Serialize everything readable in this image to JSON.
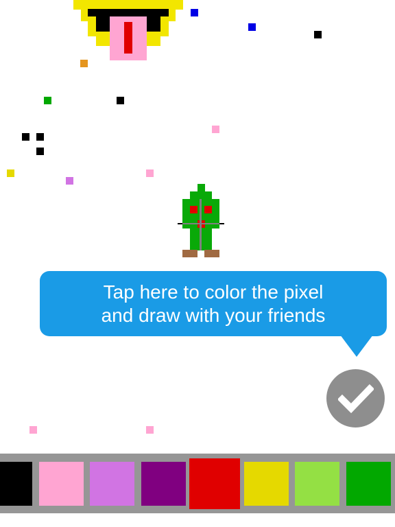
{
  "tooltip": {
    "line1": "Tap here to color the pixel",
    "line2": "and draw with your friends",
    "color": "#1a9be6"
  },
  "confirm_button": {
    "icon": "checkmark-icon",
    "color": "#8e8e8e"
  },
  "palette": {
    "background": "#969696",
    "selected_index": 4,
    "colors": [
      "#000000",
      "#ffa5d2",
      "#d174e3",
      "#800080",
      "#e00000",
      "#e5d900",
      "#94e044",
      "#02a800"
    ]
  },
  "colors": {
    "yellow": "#f2e600",
    "black": "#000000",
    "pink": "#ffa5d2",
    "red": "#e00000",
    "blue": "#0000e5",
    "orange": "#e5951e",
    "green": "#02a800",
    "purple": "#d174e3",
    "character_green": "#09a908",
    "boots": "#a06a42",
    "stick": "#808080"
  }
}
